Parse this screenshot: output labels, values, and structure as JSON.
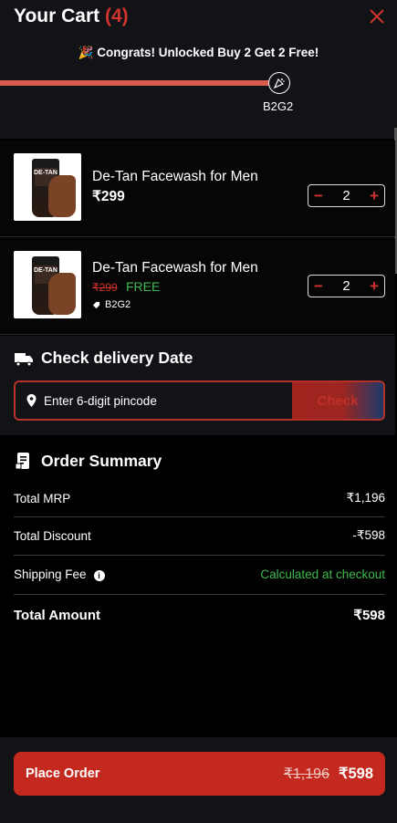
{
  "header": {
    "title": "Your Cart",
    "count": "(4)",
    "congrats": "🎉 Congrats! Unlocked Buy 2 Get 2 Free!",
    "milestone_label": "B2G2",
    "progress": 1.0
  },
  "items": [
    {
      "name": "De-Tan Facewash for Men",
      "price": "₹299",
      "qty": "2",
      "thumb_label": "DE-TAN"
    },
    {
      "name": "De-Tan Facewash for Men",
      "orig_price": "₹299",
      "free_label": "FREE",
      "tag": "B2G2",
      "qty": "2",
      "thumb_label": "DE-TAN"
    }
  ],
  "delivery": {
    "title": "Check delivery Date",
    "placeholder": "Enter 6-digit pincode",
    "check_label": "Check"
  },
  "summary": {
    "title": "Order Summary",
    "rows": [
      {
        "label": "Total MRP",
        "value": "₹1,196"
      },
      {
        "label": "Total Discount",
        "value": "-₹598"
      },
      {
        "label": "Shipping Fee",
        "value": "Calculated at checkout"
      },
      {
        "label": "Total Amount",
        "value": "₹598"
      }
    ]
  },
  "footer": {
    "place_order": "Place Order",
    "strike_price": "₹1,196",
    "final_price": "₹598"
  },
  "colors": {
    "accent": "#c3291f",
    "green": "#3fb950",
    "panel": "#111317"
  },
  "icons": [
    "close-icon",
    "confetti-icon",
    "truck-icon",
    "location-pin-icon",
    "receipt-icon",
    "tag-icon",
    "info-icon"
  ]
}
